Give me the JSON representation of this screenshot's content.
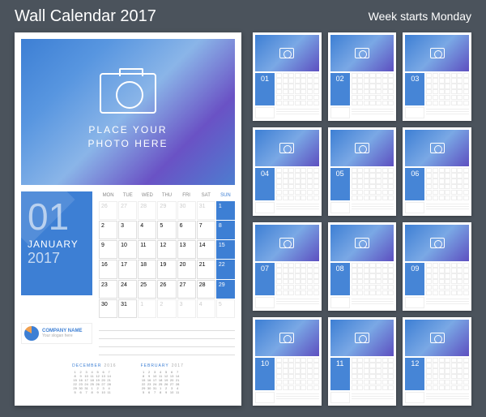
{
  "header": {
    "title": "Wall Calendar 2017",
    "subtitle": "Week starts Monday"
  },
  "photo": {
    "line1": "PLACE YOUR",
    "line2": "PHOTO HERE"
  },
  "month": {
    "num": "01",
    "name": "JANUARY",
    "year": "2017"
  },
  "dow": [
    "Mon",
    "Tue",
    "Wed",
    "Thu",
    "Fri",
    "Sat",
    "Sun"
  ],
  "days": [
    {
      "d": 26,
      "o": 1
    },
    {
      "d": 27,
      "o": 1
    },
    {
      "d": 28,
      "o": 1
    },
    {
      "d": 29,
      "o": 1
    },
    {
      "d": 30,
      "o": 1
    },
    {
      "d": 31,
      "o": 1
    },
    {
      "d": 1,
      "s": 1
    },
    {
      "d": 2
    },
    {
      "d": 3
    },
    {
      "d": 4
    },
    {
      "d": 5
    },
    {
      "d": 6
    },
    {
      "d": 7
    },
    {
      "d": 8,
      "s": 1
    },
    {
      "d": 9
    },
    {
      "d": 10
    },
    {
      "d": 11
    },
    {
      "d": 12
    },
    {
      "d": 13
    },
    {
      "d": 14
    },
    {
      "d": 15,
      "s": 1
    },
    {
      "d": 16
    },
    {
      "d": 17
    },
    {
      "d": 18
    },
    {
      "d": 19
    },
    {
      "d": 20
    },
    {
      "d": 21
    },
    {
      "d": 22,
      "s": 1
    },
    {
      "d": 23
    },
    {
      "d": 24
    },
    {
      "d": 25
    },
    {
      "d": 26
    },
    {
      "d": 27
    },
    {
      "d": 28
    },
    {
      "d": 29,
      "s": 1
    },
    {
      "d": 30
    },
    {
      "d": 31
    },
    {
      "d": 1,
      "o": 1
    },
    {
      "d": 2,
      "o": 1
    },
    {
      "d": 3,
      "o": 1
    },
    {
      "d": 4,
      "o": 1
    },
    {
      "d": 5,
      "o": 1
    }
  ],
  "company": {
    "name": "COMPANY NAME",
    "slogan": "Your slogan here"
  },
  "prev": {
    "name": "DECEMBER",
    "year": "2016"
  },
  "next": {
    "name": "FEBRUARY",
    "year": "2017"
  },
  "thumbs": [
    "01",
    "02",
    "03",
    "04",
    "05",
    "06",
    "07",
    "08",
    "09",
    "10",
    "11",
    "12"
  ]
}
